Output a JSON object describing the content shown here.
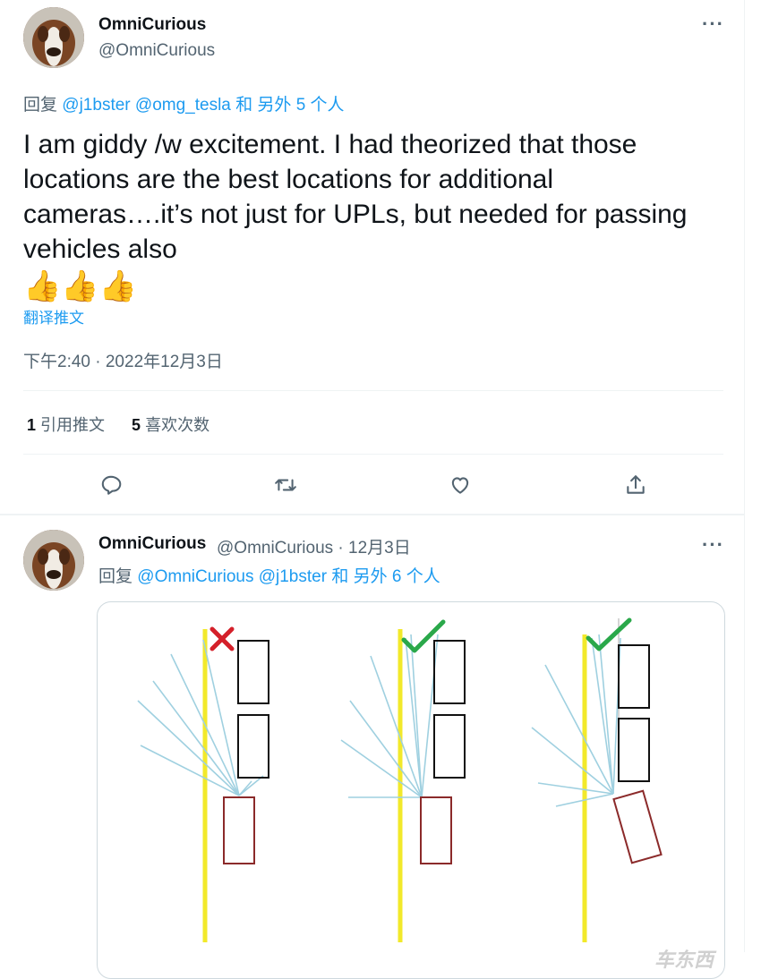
{
  "main_tweet": {
    "author_name": "OmniCurious",
    "author_handle": "@OmniCurious",
    "reply_prefix": "回复",
    "reply_mentions": [
      "@j1bster",
      "@omg_tesla"
    ],
    "reply_suffix": "和 另外 5 个人",
    "text": "I am giddy /w excitement. I had theorized that those locations are the best locations for additional cameras….it’s not just for UPLs, but needed for passing vehicles also",
    "emoji": "👍👍👍",
    "translate_label": "翻译推文",
    "timestamp": "下午2:40 · 2022年12月3日",
    "quote_count": "1",
    "quote_label": "引用推文",
    "like_count": "5",
    "like_label": "喜欢次数",
    "more": "···"
  },
  "reply_tweet": {
    "author_name": "OmniCurious",
    "author_handle_date": "@OmniCurious · 12月3日",
    "reply_prefix": "回复",
    "reply_mentions": [
      "@OmniCurious",
      "@j1bster"
    ],
    "reply_suffix": "和 另外 6 个人",
    "more": "···"
  },
  "icons": [
    "reply-icon",
    "retweet-icon",
    "like-icon",
    "share-icon",
    "more-icon",
    "cross-icon",
    "check-icon"
  ],
  "colors": {
    "accent": "#1d9bf0",
    "yellow_line": "#f2e92a",
    "ray": "#9fd0e0",
    "car_other": "#111111",
    "car_self": "#8b2a2a",
    "cross": "#d4202a",
    "check": "#2aa84a"
  },
  "watermark": "车东西"
}
